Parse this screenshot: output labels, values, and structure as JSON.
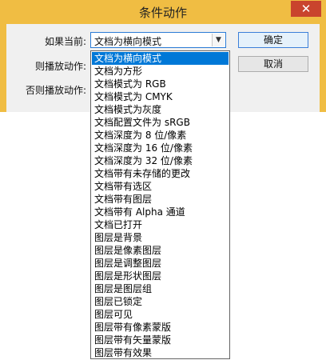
{
  "dialog": {
    "title": "条件动作",
    "close_icon": "close-icon",
    "if_label": "如果当前:",
    "then_label": "则播放动作:",
    "else_label": "否则播放动作:",
    "condition_value": "文档为横向模式",
    "ok_label": "确定",
    "cancel_label": "取消"
  },
  "dropdown": {
    "selected_index": 0,
    "options": [
      "文档为横向模式",
      "文档为方形",
      "文档模式为 RGB",
      "文档模式为 CMYK",
      "文档模式为灰度",
      "文档配置文件为 sRGB",
      "文档深度为 8 位/像素",
      "文档深度为 16 位/像素",
      "文档深度为 32 位/像素",
      "文档带有未存储的更改",
      "文档带有选区",
      "文档带有图层",
      "文档带有 Alpha 通道",
      "文档已打开",
      "图层是背景",
      "图层是像素图层",
      "图层是调整图层",
      "图层是形状图层",
      "图层是图层组",
      "图层已锁定",
      "图层可见",
      "图层带有像素蒙版",
      "图层带有矢量蒙版",
      "图层带有效果"
    ]
  },
  "colors": {
    "title_bar": "#f0bd43",
    "close_button": "#c9442d",
    "selection": "#0078d7"
  }
}
